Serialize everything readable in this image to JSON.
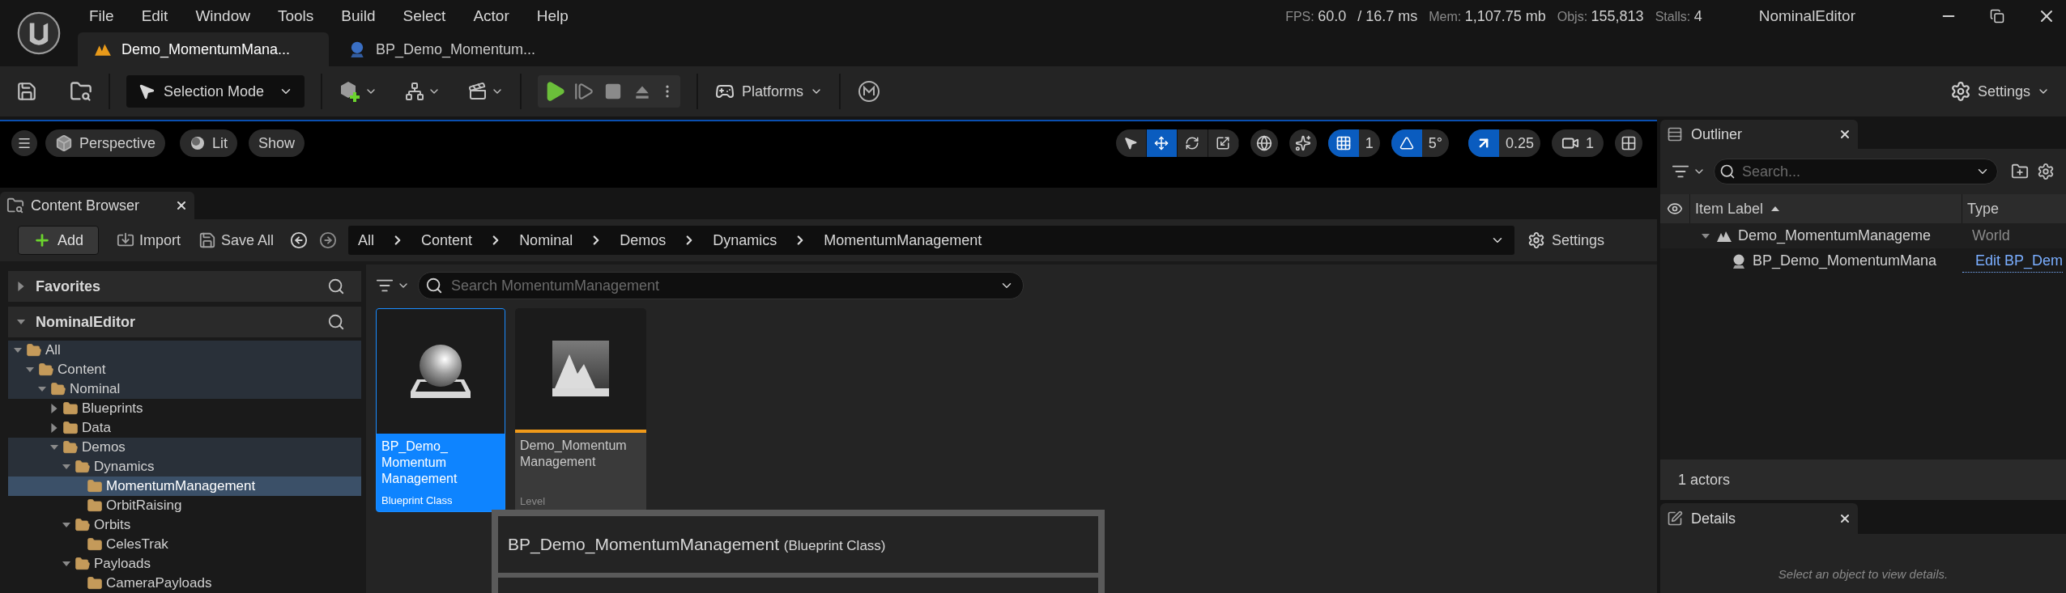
{
  "menu": [
    "File",
    "Edit",
    "Window",
    "Tools",
    "Build",
    "Select",
    "Actor",
    "Help"
  ],
  "document_tabs": [
    {
      "label": "Demo_MomentumMana...",
      "kind": "level",
      "selected": true
    },
    {
      "label": "BP_Demo_Momentum...",
      "kind": "blueprint",
      "selected": false
    }
  ],
  "stats": [
    {
      "label": "FPS:",
      "value": "60.0"
    },
    {
      "value": "/ 16.7 ms"
    },
    {
      "label": "Mem:",
      "value": "1,107.75 mb"
    },
    {
      "label": "Objs:",
      "value": "155,813"
    },
    {
      "label": "Stalls:",
      "value": "4"
    }
  ],
  "project_name": "NominalEditor",
  "toolbar": {
    "selection_mode": "Selection Mode",
    "platforms": "Platforms",
    "settings": "Settings"
  },
  "viewport": {
    "view_mode": "Perspective",
    "lighting": "Lit",
    "show": "Show",
    "transform_tools": [
      {
        "kind": "select",
        "selected": false
      },
      {
        "kind": "move",
        "selected": true
      },
      {
        "kind": "rotate",
        "selected": false
      },
      {
        "kind": "scale",
        "selected": false
      }
    ],
    "grid_snap": {
      "on": true,
      "value": "1"
    },
    "rotation_snap": {
      "on": true,
      "value": "5°"
    },
    "scale_snap": {
      "on": true,
      "value": "0.25"
    },
    "camera_speed": "1"
  },
  "content_browser": {
    "title": "Content Browser",
    "add": "Add",
    "import": "Import",
    "save_all": "Save All",
    "breadcrumb": [
      "All",
      "Content",
      "Nominal",
      "Demos",
      "Dynamics",
      "MomentumManagement"
    ],
    "settings": "Settings",
    "search": {
      "placeholder": "Search MomentumManagement"
    },
    "sections": [
      {
        "label": "Favorites",
        "expanded": false
      },
      {
        "label": "NominalEditor",
        "expanded": true
      }
    ],
    "tree": [
      {
        "label": "All",
        "kind": "branch",
        "expanded": true,
        "in_path": true,
        "selected": false,
        "children": [
          {
            "label": "Content",
            "kind": "branch",
            "expanded": true,
            "in_path": true,
            "selected": false,
            "children": [
              {
                "label": "Nominal",
                "kind": "branch",
                "expanded": true,
                "in_path": true,
                "selected": false,
                "children": [
                  {
                    "label": "Blueprints",
                    "kind": "branch",
                    "expanded": false,
                    "in_path": false,
                    "selected": false
                  },
                  {
                    "label": "Data",
                    "kind": "branch",
                    "expanded": false,
                    "in_path": false,
                    "selected": false
                  },
                  {
                    "label": "Demos",
                    "kind": "branch",
                    "expanded": true,
                    "in_path": true,
                    "selected": false,
                    "children": [
                      {
                        "label": "Dynamics",
                        "kind": "branch",
                        "expanded": true,
                        "in_path": true,
                        "selected": false,
                        "children": [
                          {
                            "label": "MomentumManagement",
                            "kind": "leaf",
                            "selected": true
                          },
                          {
                            "label": "OrbitRaising",
                            "kind": "leaf",
                            "in_path": false,
                            "selected": false
                          }
                        ]
                      },
                      {
                        "label": "Orbits",
                        "kind": "branch",
                        "expanded": true,
                        "in_path": false,
                        "selected": false,
                        "children": [
                          {
                            "label": "CelesTrak",
                            "kind": "leaf",
                            "in_path": false,
                            "selected": false
                          }
                        ]
                      },
                      {
                        "label": "Payloads",
                        "kind": "branch",
                        "expanded": true,
                        "in_path": false,
                        "selected": false,
                        "children": [
                          {
                            "label": "CameraPayloads",
                            "kind": "leaf",
                            "in_path": false,
                            "selected": false
                          }
                        ]
                      }
                    ]
                  }
                ]
              }
            ]
          }
        ]
      }
    ],
    "assets": [
      {
        "name_lines": [
          "BP_Demo_",
          "Momentum",
          "Management"
        ],
        "type": "Blueprint Class",
        "kind": "blueprint",
        "selected": true
      },
      {
        "name_lines": [
          "Demo_Momentum",
          "Management"
        ],
        "type": "Level",
        "kind": "level",
        "selected": false
      }
    ],
    "tooltip": {
      "title": "BP_Demo_MomentumManagement",
      "subtitle": "(Blueprint Class)"
    }
  },
  "outliner": {
    "title": "Outliner",
    "search": {
      "placeholder": "Search..."
    },
    "columns": [
      "Item Label",
      "Type"
    ],
    "rows": [
      {
        "label": "Demo_MomentumManageme",
        "type": "World",
        "kind": "level",
        "expanded": true,
        "children": [
          {
            "label": "BP_Demo_MomentumMana",
            "type": "Edit BP_Dem",
            "kind": "blueprint"
          }
        ]
      }
    ],
    "footer": "1 actors"
  },
  "details": {
    "title": "Details",
    "message": "Select an object to view details."
  }
}
